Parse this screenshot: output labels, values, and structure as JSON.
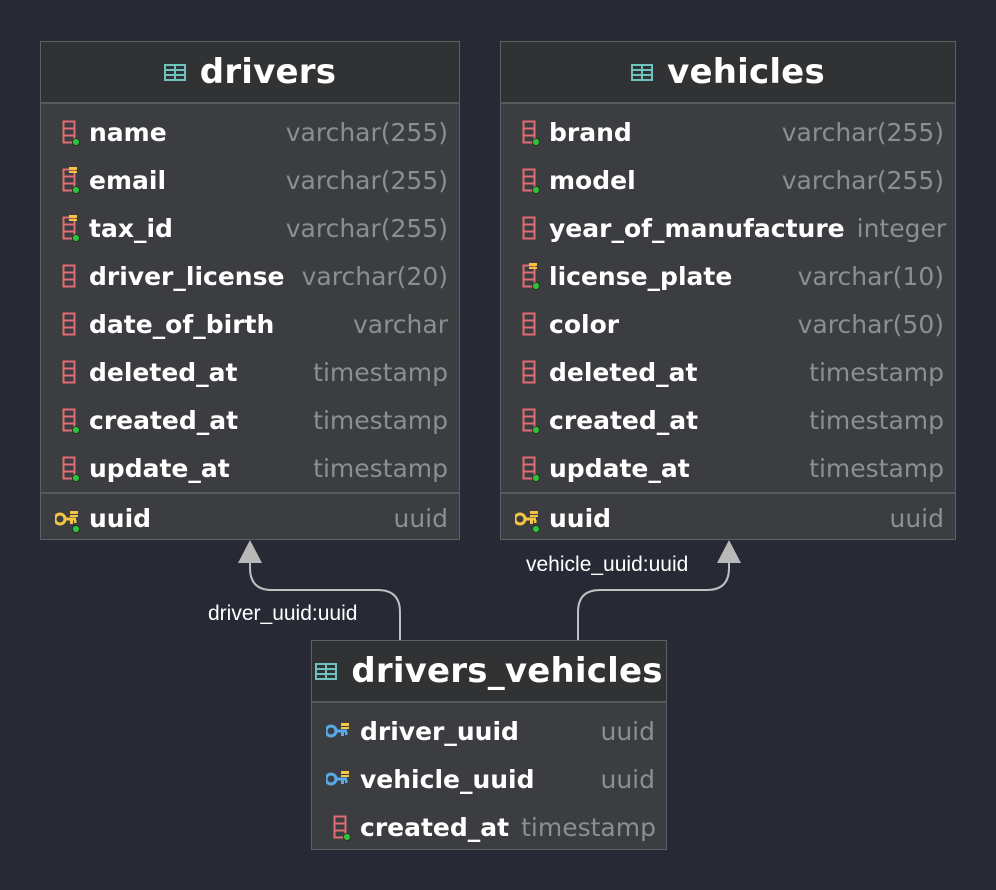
{
  "colors": {
    "background": "#272935",
    "table_body": "#3b3d40",
    "table_header": "#313234",
    "column_name": "#ffffff",
    "column_type": "#8c8e92",
    "column_icon": "#e06c75",
    "key_icon_yellow": "#f5c542",
    "key_icon_blue": "#5aa9e6",
    "table_icon": "#6fc2bd",
    "not_null_dot": "#2fc13b",
    "link_line": "#bfbfbf"
  },
  "tables": {
    "drivers": {
      "name": "drivers",
      "columns": [
        {
          "name": "name",
          "type": "varchar(255)",
          "icon": "column-notnull-icon"
        },
        {
          "name": "email",
          "type": "varchar(255)",
          "icon": "unique-index-icon"
        },
        {
          "name": "tax_id",
          "type": "varchar(255)",
          "icon": "unique-index-icon"
        },
        {
          "name": "driver_license",
          "type": "varchar(20)",
          "icon": "column-icon"
        },
        {
          "name": "date_of_birth",
          "type": "varchar",
          "icon": "column-icon"
        },
        {
          "name": "deleted_at",
          "type": "timestamp",
          "icon": "column-icon"
        },
        {
          "name": "created_at",
          "type": "timestamp",
          "icon": "column-notnull-icon"
        },
        {
          "name": "update_at",
          "type": "timestamp",
          "icon": "column-notnull-icon"
        }
      ],
      "pk": {
        "name": "uuid",
        "type": "uuid",
        "icon": "primary-key-icon"
      }
    },
    "vehicles": {
      "name": "vehicles",
      "columns": [
        {
          "name": "brand",
          "type": "varchar(255)",
          "icon": "column-notnull-icon"
        },
        {
          "name": "model",
          "type": "varchar(255)",
          "icon": "column-notnull-icon"
        },
        {
          "name": "year_of_manufacture",
          "type": "integer",
          "icon": "column-icon"
        },
        {
          "name": "license_plate",
          "type": "varchar(10)",
          "icon": "unique-index-icon"
        },
        {
          "name": "color",
          "type": "varchar(50)",
          "icon": "column-icon"
        },
        {
          "name": "deleted_at",
          "type": "timestamp",
          "icon": "column-icon"
        },
        {
          "name": "created_at",
          "type": "timestamp",
          "icon": "column-notnull-icon"
        },
        {
          "name": "update_at",
          "type": "timestamp",
          "icon": "column-notnull-icon"
        }
      ],
      "pk": {
        "name": "uuid",
        "type": "uuid",
        "icon": "primary-key-icon"
      }
    },
    "drivers_vehicles": {
      "name": "drivers_vehicles",
      "columns": [
        {
          "name": "driver_uuid",
          "type": "uuid",
          "icon": "foreign-key-icon"
        },
        {
          "name": "vehicle_uuid",
          "type": "uuid",
          "icon": "foreign-key-icon"
        },
        {
          "name": "created_at",
          "type": "timestamp",
          "icon": "column-notnull-icon"
        }
      ]
    }
  },
  "relations": {
    "driver": {
      "label": "driver_uuid:uuid"
    },
    "vehicle": {
      "label": "vehicle_uuid:uuid"
    }
  }
}
